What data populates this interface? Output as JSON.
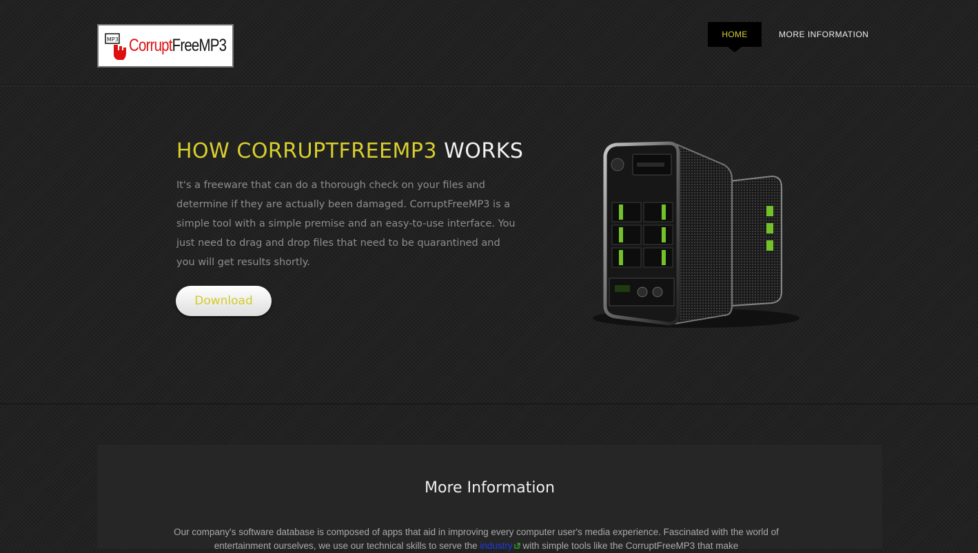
{
  "header": {
    "logo": {
      "mark_text": "MP3",
      "text_red": "Corrupt",
      "text_black": "FreeMP3"
    },
    "nav": {
      "home_label": "HOME",
      "more_label": "MORE INFORMATION"
    }
  },
  "hero": {
    "title_highlight": "HOW CORRUPTFREEMP3",
    "title_rest": "WORKS",
    "description": "It's a freeware that can do a thorough check on your files and determine if they are actually been damaged. CorruptFreeMP3 is a simple tool with a simple premise and an easy-to-use interface. You just need to drag and drop files that need to be quarantined and you will get results shortly.",
    "download_label": "Download"
  },
  "info": {
    "title": "More Information",
    "text_before": "Our company's software database is composed of apps that aid in improving every computer user's media experience. Fascinated with the world of entertainment ourselves, we use our technical skills to serve the",
    "link_text": "industry",
    "text_after": "with simple tools like the CorruptFreeMP3 that make"
  },
  "colors": {
    "accent_yellow": "#d8cf2e",
    "background": "#222222",
    "panel": "#262626",
    "link": "#1c38e8"
  }
}
